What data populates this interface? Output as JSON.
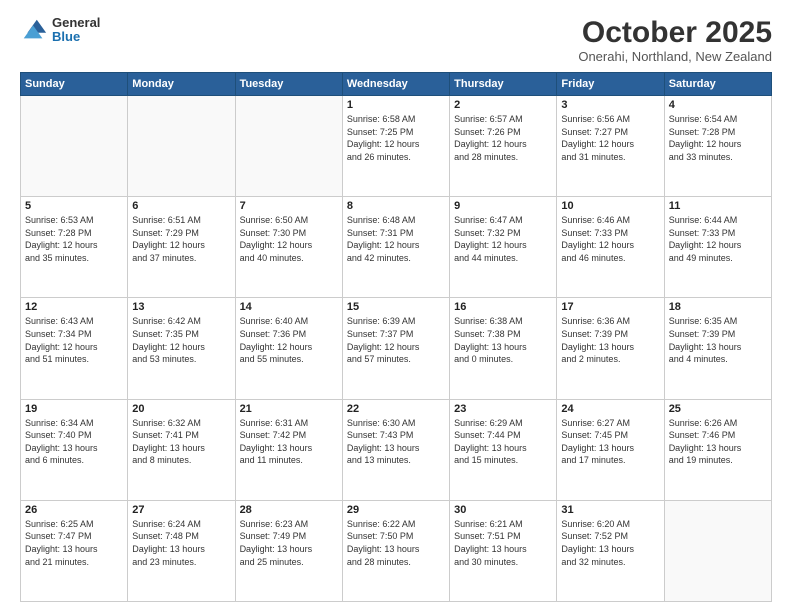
{
  "logo": {
    "general": "General",
    "blue": "Blue"
  },
  "header": {
    "month": "October 2025",
    "location": "Onerahi, Northland, New Zealand"
  },
  "days_of_week": [
    "Sunday",
    "Monday",
    "Tuesday",
    "Wednesday",
    "Thursday",
    "Friday",
    "Saturday"
  ],
  "weeks": [
    [
      {
        "day": "",
        "info": ""
      },
      {
        "day": "",
        "info": ""
      },
      {
        "day": "",
        "info": ""
      },
      {
        "day": "1",
        "info": "Sunrise: 6:58 AM\nSunset: 7:25 PM\nDaylight: 12 hours\nand 26 minutes."
      },
      {
        "day": "2",
        "info": "Sunrise: 6:57 AM\nSunset: 7:26 PM\nDaylight: 12 hours\nand 28 minutes."
      },
      {
        "day": "3",
        "info": "Sunrise: 6:56 AM\nSunset: 7:27 PM\nDaylight: 12 hours\nand 31 minutes."
      },
      {
        "day": "4",
        "info": "Sunrise: 6:54 AM\nSunset: 7:28 PM\nDaylight: 12 hours\nand 33 minutes."
      }
    ],
    [
      {
        "day": "5",
        "info": "Sunrise: 6:53 AM\nSunset: 7:28 PM\nDaylight: 12 hours\nand 35 minutes."
      },
      {
        "day": "6",
        "info": "Sunrise: 6:51 AM\nSunset: 7:29 PM\nDaylight: 12 hours\nand 37 minutes."
      },
      {
        "day": "7",
        "info": "Sunrise: 6:50 AM\nSunset: 7:30 PM\nDaylight: 12 hours\nand 40 minutes."
      },
      {
        "day": "8",
        "info": "Sunrise: 6:48 AM\nSunset: 7:31 PM\nDaylight: 12 hours\nand 42 minutes."
      },
      {
        "day": "9",
        "info": "Sunrise: 6:47 AM\nSunset: 7:32 PM\nDaylight: 12 hours\nand 44 minutes."
      },
      {
        "day": "10",
        "info": "Sunrise: 6:46 AM\nSunset: 7:33 PM\nDaylight: 12 hours\nand 46 minutes."
      },
      {
        "day": "11",
        "info": "Sunrise: 6:44 AM\nSunset: 7:33 PM\nDaylight: 12 hours\nand 49 minutes."
      }
    ],
    [
      {
        "day": "12",
        "info": "Sunrise: 6:43 AM\nSunset: 7:34 PM\nDaylight: 12 hours\nand 51 minutes."
      },
      {
        "day": "13",
        "info": "Sunrise: 6:42 AM\nSunset: 7:35 PM\nDaylight: 12 hours\nand 53 minutes."
      },
      {
        "day": "14",
        "info": "Sunrise: 6:40 AM\nSunset: 7:36 PM\nDaylight: 12 hours\nand 55 minutes."
      },
      {
        "day": "15",
        "info": "Sunrise: 6:39 AM\nSunset: 7:37 PM\nDaylight: 12 hours\nand 57 minutes."
      },
      {
        "day": "16",
        "info": "Sunrise: 6:38 AM\nSunset: 7:38 PM\nDaylight: 13 hours\nand 0 minutes."
      },
      {
        "day": "17",
        "info": "Sunrise: 6:36 AM\nSunset: 7:39 PM\nDaylight: 13 hours\nand 2 minutes."
      },
      {
        "day": "18",
        "info": "Sunrise: 6:35 AM\nSunset: 7:39 PM\nDaylight: 13 hours\nand 4 minutes."
      }
    ],
    [
      {
        "day": "19",
        "info": "Sunrise: 6:34 AM\nSunset: 7:40 PM\nDaylight: 13 hours\nand 6 minutes."
      },
      {
        "day": "20",
        "info": "Sunrise: 6:32 AM\nSunset: 7:41 PM\nDaylight: 13 hours\nand 8 minutes."
      },
      {
        "day": "21",
        "info": "Sunrise: 6:31 AM\nSunset: 7:42 PM\nDaylight: 13 hours\nand 11 minutes."
      },
      {
        "day": "22",
        "info": "Sunrise: 6:30 AM\nSunset: 7:43 PM\nDaylight: 13 hours\nand 13 minutes."
      },
      {
        "day": "23",
        "info": "Sunrise: 6:29 AM\nSunset: 7:44 PM\nDaylight: 13 hours\nand 15 minutes."
      },
      {
        "day": "24",
        "info": "Sunrise: 6:27 AM\nSunset: 7:45 PM\nDaylight: 13 hours\nand 17 minutes."
      },
      {
        "day": "25",
        "info": "Sunrise: 6:26 AM\nSunset: 7:46 PM\nDaylight: 13 hours\nand 19 minutes."
      }
    ],
    [
      {
        "day": "26",
        "info": "Sunrise: 6:25 AM\nSunset: 7:47 PM\nDaylight: 13 hours\nand 21 minutes."
      },
      {
        "day": "27",
        "info": "Sunrise: 6:24 AM\nSunset: 7:48 PM\nDaylight: 13 hours\nand 23 minutes."
      },
      {
        "day": "28",
        "info": "Sunrise: 6:23 AM\nSunset: 7:49 PM\nDaylight: 13 hours\nand 25 minutes."
      },
      {
        "day": "29",
        "info": "Sunrise: 6:22 AM\nSunset: 7:50 PM\nDaylight: 13 hours\nand 28 minutes."
      },
      {
        "day": "30",
        "info": "Sunrise: 6:21 AM\nSunset: 7:51 PM\nDaylight: 13 hours\nand 30 minutes."
      },
      {
        "day": "31",
        "info": "Sunrise: 6:20 AM\nSunset: 7:52 PM\nDaylight: 13 hours\nand 32 minutes."
      },
      {
        "day": "",
        "info": ""
      }
    ]
  ]
}
